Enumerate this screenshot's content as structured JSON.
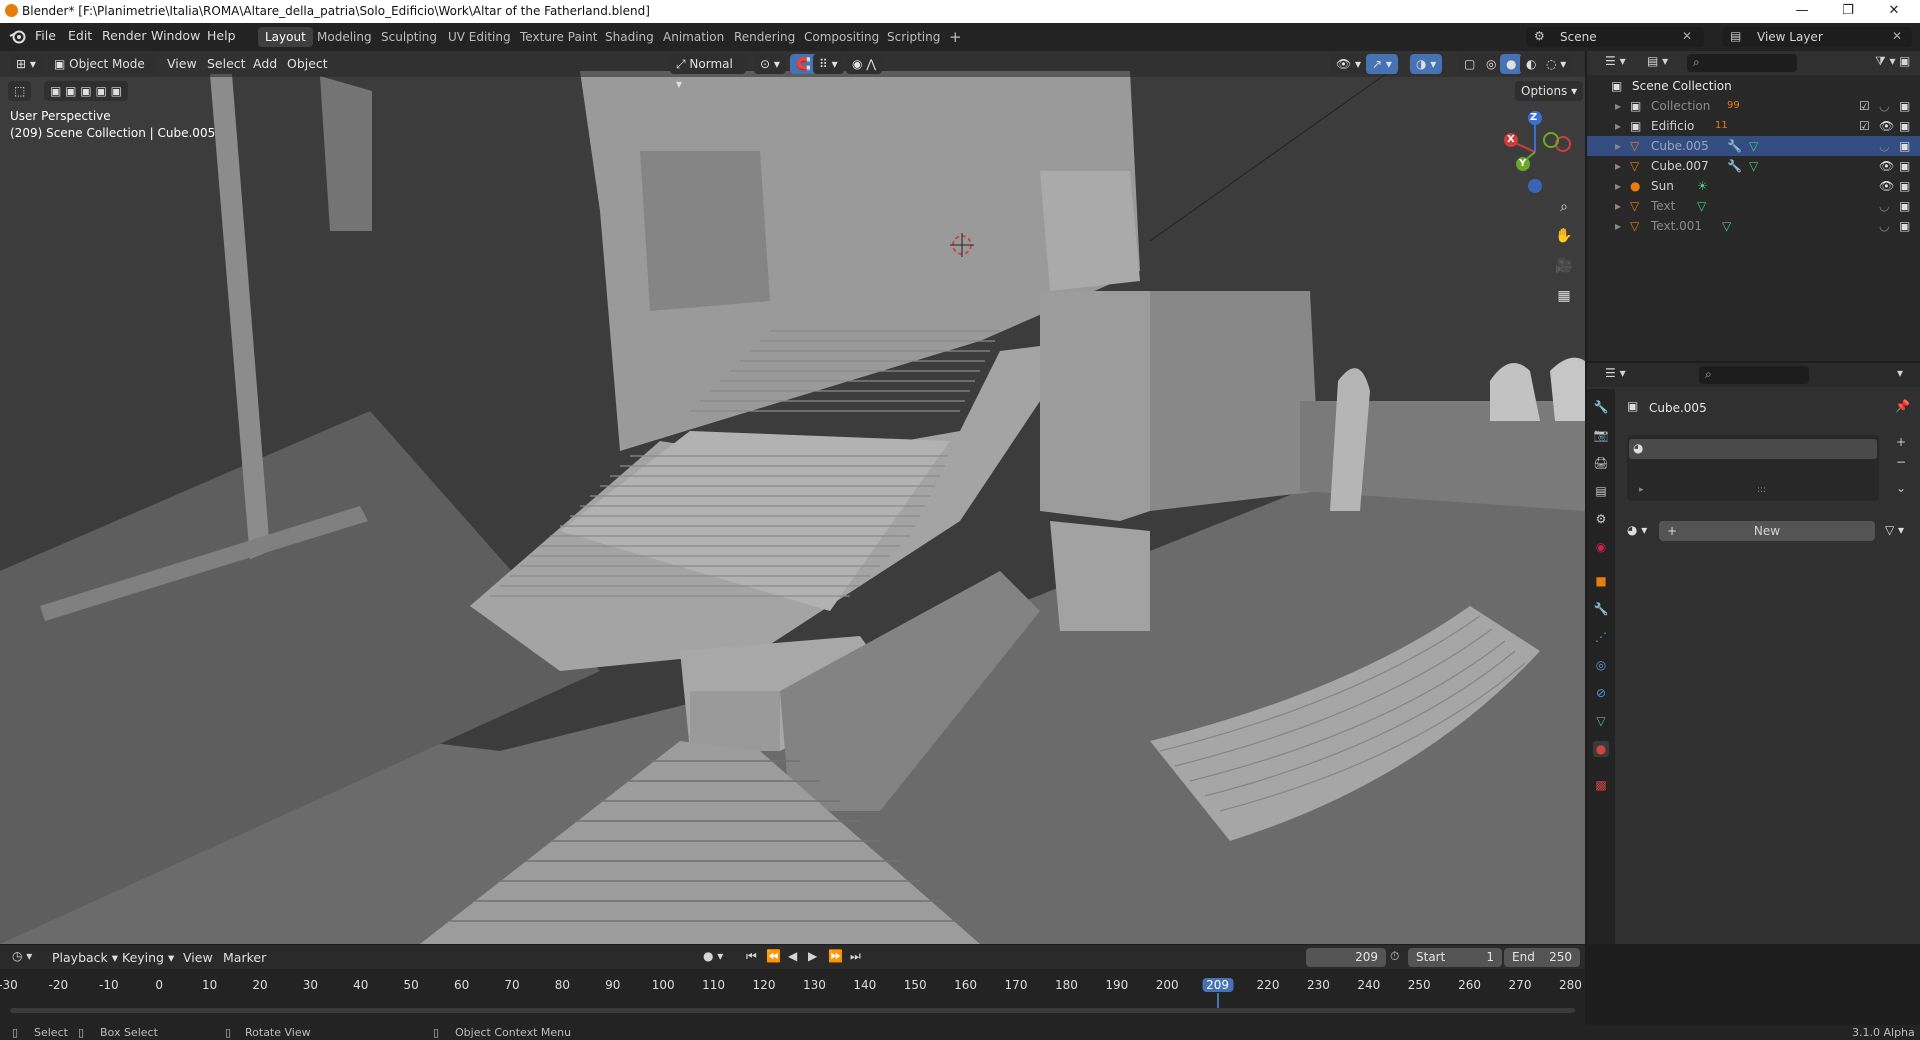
{
  "window": {
    "title": "Blender* [F:\\Planimetrie\\Italia\\ROMA\\Altare_della_patria\\Solo_Edificio\\Work\\Altar of the Fatherland.blend]",
    "minimize": "—",
    "maximize": "❐",
    "close": "✕"
  },
  "topbar": {
    "menus": [
      "File",
      "Edit",
      "Render",
      "Window",
      "Help"
    ],
    "workspaces": [
      "Layout",
      "Modeling",
      "Sculpting",
      "UV Editing",
      "Texture Paint",
      "Shading",
      "Animation",
      "Rendering",
      "Compositing",
      "Scripting"
    ],
    "active_workspace": "Layout",
    "add_workspace": "+",
    "scene": "Scene",
    "view_layer": "View Layer"
  },
  "viewport": {
    "mode": "Object Mode",
    "menus": [
      "View",
      "Select",
      "Add",
      "Object"
    ],
    "orientation": "Normal",
    "options": "Options",
    "perspective": "User Perspective",
    "collection_info": "(209) Scene Collection | Cube.005",
    "gizmo": {
      "x": "X",
      "y": "Y",
      "z": "Z"
    }
  },
  "outliner": {
    "root": "Scene Collection",
    "items": [
      {
        "name": "Collection",
        "badge": "99",
        "type": "collection",
        "selected": false
      },
      {
        "name": "Edificio",
        "badge": "11",
        "type": "collection",
        "selected": false
      },
      {
        "name": "Cube.005",
        "type": "mesh",
        "selected": true
      },
      {
        "name": "Cube.007",
        "type": "mesh",
        "selected": false
      },
      {
        "name": "Sun",
        "type": "light",
        "selected": false
      },
      {
        "name": "Text",
        "type": "text",
        "selected": false
      },
      {
        "name": "Text.001",
        "type": "text",
        "selected": false
      }
    ]
  },
  "properties": {
    "object": "Cube.005",
    "new_button": "New",
    "add": "+",
    "remove": "−",
    "more": "⌄"
  },
  "timeline": {
    "menus": [
      "Playback",
      "Keying",
      "View",
      "Marker"
    ],
    "current_frame": "209",
    "start_label": "Start",
    "start": "1",
    "end_label": "End",
    "end": "250",
    "ticks": [
      "-30",
      "-20",
      "-10",
      "0",
      "10",
      "20",
      "30",
      "40",
      "50",
      "60",
      "70",
      "80",
      "90",
      "100",
      "110",
      "120",
      "130",
      "140",
      "150",
      "160",
      "170",
      "180",
      "190",
      "200",
      "209",
      "220",
      "230",
      "240",
      "250",
      "260",
      "270",
      "280"
    ]
  },
  "statusbar": {
    "select": "Select",
    "box_select": "Box Select",
    "rotate_view": "Rotate View",
    "context_menu": "Object Context Menu",
    "version": "3.1.0 Alpha"
  },
  "colors": {
    "accent": "#4772b3",
    "selected_row": "#334d80",
    "orange": "#e87d0d"
  }
}
